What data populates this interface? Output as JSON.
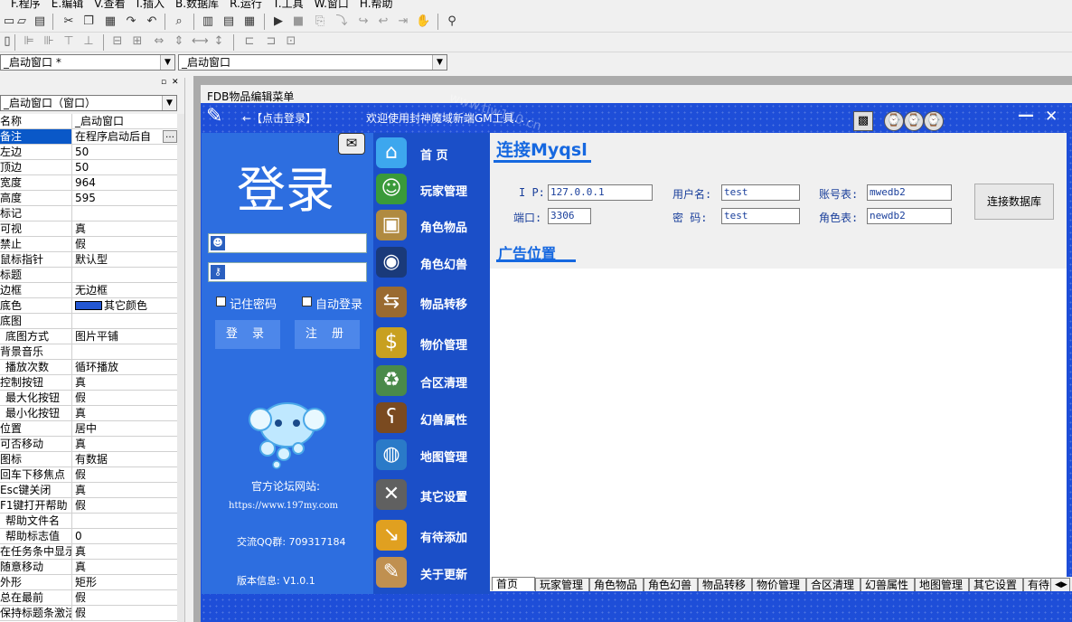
{
  "menubar": {
    "items": [
      "F.程序",
      "E.编辑",
      "V.查看",
      "I.插入",
      "B.数据库",
      "R.运行",
      "T.工具",
      "W.窗口",
      "H.帮助"
    ]
  },
  "combos": {
    "window1": "_启动窗口 *",
    "window2": "_启动窗口",
    "object": "_启动窗口（窗口）"
  },
  "properties": [
    {
      "name": "名称",
      "value": "_启动窗口"
    },
    {
      "name": "备注",
      "value": "在程序启动后自",
      "selected": true
    },
    {
      "name": "左边",
      "value": "50"
    },
    {
      "name": "顶边",
      "value": "50"
    },
    {
      "name": "宽度",
      "value": "964"
    },
    {
      "name": "高度",
      "value": "595"
    },
    {
      "name": "标记",
      "value": ""
    },
    {
      "name": "可视",
      "value": "真"
    },
    {
      "name": "禁止",
      "value": "假"
    },
    {
      "name": "鼠标指针",
      "value": "默认型"
    },
    {
      "name": "标题",
      "value": ""
    },
    {
      "name": "边框",
      "value": "无边框"
    },
    {
      "name": "底色",
      "value": "其它颜色",
      "swatch": "#2357d3"
    },
    {
      "name": "底图",
      "value": ""
    },
    {
      "name": "底图方式",
      "value": "图片平铺",
      "indent": true
    },
    {
      "name": "背景音乐",
      "value": ""
    },
    {
      "name": "播放次数",
      "value": "循环播放",
      "indent": true
    },
    {
      "name": "控制按钮",
      "value": "真"
    },
    {
      "name": "最大化按钮",
      "value": "假",
      "indent": true
    },
    {
      "name": "最小化按钮",
      "value": "真",
      "indent": true
    },
    {
      "name": "位置",
      "value": "居中"
    },
    {
      "name": "可否移动",
      "value": "真"
    },
    {
      "name": "图标",
      "value": "有数据"
    },
    {
      "name": "回车下移焦点",
      "value": "假"
    },
    {
      "name": "Esc键关闭",
      "value": "真"
    },
    {
      "name": "F1键打开帮助",
      "value": "假"
    },
    {
      "name": "帮助文件名",
      "value": "",
      "indent": true
    },
    {
      "name": "帮助标志值",
      "value": "0",
      "indent": true
    },
    {
      "name": "在任务条中显示",
      "value": "真"
    },
    {
      "name": "随意移动",
      "value": "真"
    },
    {
      "name": "外形",
      "value": "矩形"
    },
    {
      "name": "总在最前",
      "value": "假"
    },
    {
      "name": "保持标题条激活",
      "value": "假"
    }
  ],
  "designer": {
    "form_title": "FDB物品编辑菜单"
  },
  "app": {
    "back_link": "←【点击登录】",
    "welcome": "欢迎使用封神魔域新端GM工具. . .",
    "minimize": "—",
    "close": "✕",
    "login_title": "登录",
    "remember_pwd": "记住密码",
    "auto_login": "自动登录",
    "btn_login": "登 录",
    "btn_register": "注 册",
    "forum_label": "官方论坛网站:",
    "forum_url": "https://www.197my.com",
    "qq_group": "交流QQ群: 709317184",
    "version": "版本信息: V1.0.1",
    "watermark": "www.tjw110.cn"
  },
  "nav": [
    {
      "label": "首  页",
      "icon": "house-icon",
      "glyph": "⌂",
      "color": "#3da7ee"
    },
    {
      "label": "玩家管理",
      "icon": "user-icon",
      "glyph": "☺",
      "color": "#3a9a3a"
    },
    {
      "label": "角色物品",
      "icon": "box-icon",
      "glyph": "▣",
      "color": "#b08a40"
    },
    {
      "label": "角色幻兽",
      "icon": "penguin-icon",
      "glyph": "◉",
      "color": "#1a3a7a"
    },
    {
      "label": "物品转移",
      "icon": "signpost-icon",
      "glyph": "⇆",
      "color": "#9a6a30"
    },
    {
      "label": "物价管理",
      "icon": "coins-icon",
      "glyph": "$",
      "color": "#c8a020"
    },
    {
      "label": "合区清理",
      "icon": "recycle-icon",
      "glyph": "♻",
      "color": "#4a8a4a"
    },
    {
      "label": "幻兽属性",
      "icon": "bear-icon",
      "glyph": "ʕ",
      "color": "#7a4a20"
    },
    {
      "label": "地图管理",
      "icon": "globe-icon",
      "glyph": "◍",
      "color": "#2a7ac8"
    },
    {
      "label": "其它设置",
      "icon": "tools-icon",
      "glyph": "✕",
      "color": "#606060"
    },
    {
      "label": "有待添加",
      "icon": "arrows-icon",
      "glyph": "↘",
      "color": "#e0a020"
    },
    {
      "label": "关于更新",
      "icon": "clipboard-icon",
      "glyph": "✎",
      "color": "#c09050"
    }
  ],
  "mysql": {
    "title": "连接Myqsl",
    "ip_label": "I P:",
    "ip": "127.0.0.1",
    "port_label": "端口:",
    "port": "3306",
    "user_label": "用户名:",
    "user": "test",
    "pwd_label": "密  码:",
    "pwd": "test",
    "acct_label": "账号表:",
    "acct": "mwedb2",
    "role_label": "角色表:",
    "role": "newdb2",
    "connect_btn": "连接数据库"
  },
  "ad": {
    "title": "广告位置"
  },
  "tabs": [
    "首页",
    "玩家管理",
    "角色物品",
    "角色幻兽",
    "物品转移",
    "物价管理",
    "合区清理",
    "幻兽属性",
    "地图管理",
    "其它设置",
    "有待"
  ]
}
